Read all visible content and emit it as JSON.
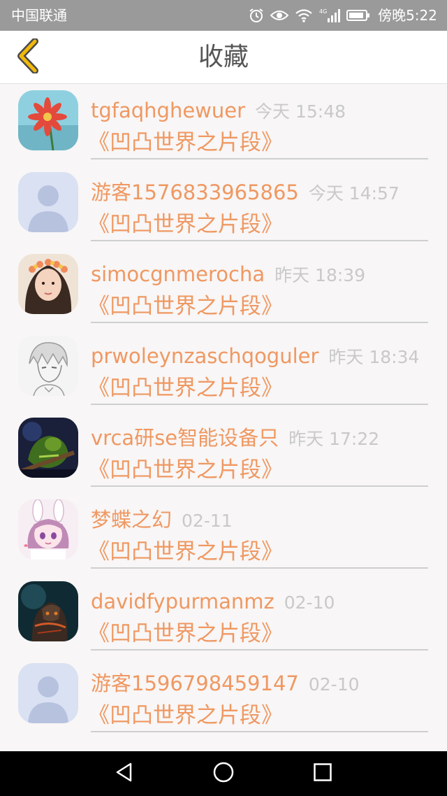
{
  "status_bar": {
    "carrier": "中国联通",
    "network": "4G",
    "time": "傍晚5:22"
  },
  "header": {
    "title": "收藏",
    "back_icon": "chevron-left-icon",
    "accent_color": "#f2b90c"
  },
  "colors": {
    "name": "#ef9862",
    "time": "#c9c9c9",
    "background": "#f8f6f6"
  },
  "items": [
    {
      "username": "tgfaqhghewuer",
      "time": "今天 15:48",
      "title": "《凹凸世界之片段》",
      "avatar": "flower-avatar"
    },
    {
      "username": "游客1576833965865",
      "time": "今天 14:57",
      "title": "《凹凸世界之片段》",
      "avatar": "default-avatar"
    },
    {
      "username": "simocgnmerocha",
      "time": "昨天 18:39",
      "title": "《凹凸世界之片段》",
      "avatar": "girl-avatar"
    },
    {
      "username": "prwoleynzaschqoguler",
      "time": "昨天 18:34",
      "title": "《凹凸世界之片段》",
      "avatar": "sketch-avatar"
    },
    {
      "username": "vrca研se智能设备只",
      "time": "昨天 17:22",
      "title": "《凹凸世界之片段》",
      "avatar": "warrior-avatar"
    },
    {
      "username": "梦蝶之幻",
      "time": "02-11",
      "title": "《凹凸世界之片段》",
      "avatar": "anime-bunny-avatar"
    },
    {
      "username": "davidfypurmanmz",
      "time": "02-10",
      "title": "《凹凸世界之片段》",
      "avatar": "dark-knight-avatar"
    },
    {
      "username": "游客1596798459147",
      "time": "02-10",
      "title": "《凹凸世界之片段》",
      "avatar": "default-avatar"
    }
  ],
  "nav": {
    "back_icon": "triangle-back-icon",
    "home_icon": "circle-home-icon",
    "recents_icon": "square-recents-icon"
  }
}
